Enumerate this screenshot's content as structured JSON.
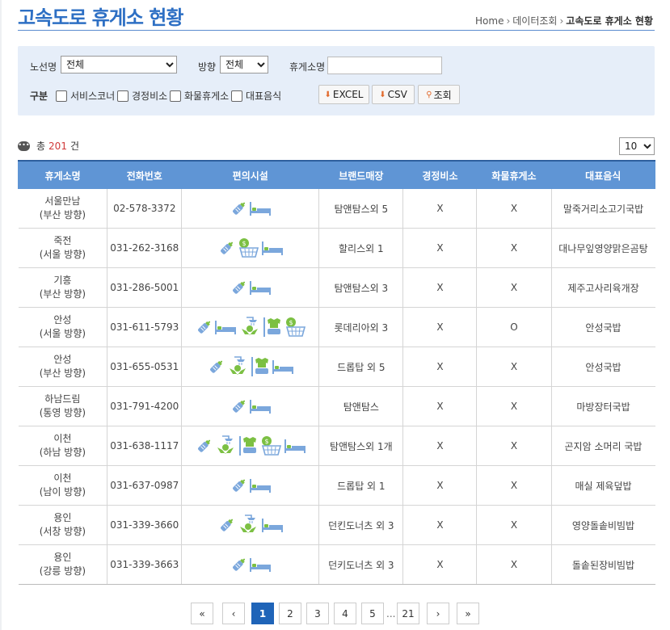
{
  "page": {
    "title": "고속도로 휴게소 현황",
    "breadcrumb": [
      "Home",
      "데이터조회",
      "고속도로 휴게소 현황"
    ]
  },
  "filter": {
    "route_label": "노선명",
    "route_value": "전체",
    "direction_label": "방향",
    "direction_value": "전체",
    "name_label": "휴게소명",
    "name_value": "",
    "category_label": "구분",
    "checkboxes": [
      "서비스코너",
      "경정비소",
      "화물휴게소",
      "대표음식"
    ],
    "excel_label": "EXCEL",
    "csv_label": "CSV",
    "search_label": "조회"
  },
  "summary": {
    "prefix": "총",
    "count": "201",
    "suffix": "건",
    "page_size": "10"
  },
  "table": {
    "headers": [
      "휴게소명",
      "전화번호",
      "편의시설",
      "브랜드매장",
      "경정비소",
      "화물휴게소",
      "대표음식"
    ],
    "rows": [
      {
        "name": "서울만남",
        "dir": "(부산 방향)",
        "phone": "02-578-3372",
        "facilities": [
          "nursing-bottle",
          "bed"
        ],
        "brand": "탐앤탐스외 5",
        "repair": "X",
        "truck": "X",
        "food": "말죽거리소고기국밥"
      },
      {
        "name": "죽전",
        "dir": "(서울 방향)",
        "phone": "031-262-3168",
        "facilities": [
          "nursing-bottle",
          "basket",
          "bed"
        ],
        "brand": "할리스외 1",
        "repair": "X",
        "truck": "X",
        "food": "대나무잎영양맑은곰탕"
      },
      {
        "name": "기흥",
        "dir": "(부산 방향)",
        "phone": "031-286-5001",
        "facilities": [
          "nursing-bottle",
          "bed"
        ],
        "brand": "탐앤탐스외 3",
        "repair": "X",
        "truck": "X",
        "food": "제주고사리육개장"
      },
      {
        "name": "안성",
        "dir": "(서울 방향)",
        "phone": "031-611-5793",
        "facilities": [
          "nursing-bottle",
          "bed",
          "shower",
          "laundry",
          "basket"
        ],
        "brand": "롯데리아외 3",
        "repair": "X",
        "truck": "O",
        "food": "안성국밥"
      },
      {
        "name": "안성",
        "dir": "(부산 방향)",
        "phone": "031-655-0531",
        "facilities": [
          "nursing-bottle",
          "shower",
          "laundry",
          "bed"
        ],
        "brand": "드롭탑 외 5",
        "repair": "X",
        "truck": "X",
        "food": "안성국밥"
      },
      {
        "name": "하남드림",
        "dir": "(통영 방향)",
        "phone": "031-791-4200",
        "facilities": [
          "nursing-bottle",
          "bed"
        ],
        "brand": "탐앤탐스",
        "repair": "X",
        "truck": "X",
        "food": "마방장터국밥"
      },
      {
        "name": "이천",
        "dir": "(하남 방향)",
        "phone": "031-638-1117",
        "facilities": [
          "nursing-bottle",
          "shower",
          "laundry",
          "basket",
          "bed"
        ],
        "brand": "탐앤탐스외 1개",
        "repair": "X",
        "truck": "X",
        "food": "곤지암 소머리 국밥"
      },
      {
        "name": "이천",
        "dir": "(남이 방향)",
        "phone": "031-637-0987",
        "facilities": [
          "nursing-bottle",
          "bed"
        ],
        "brand": "드롭탑 외 1",
        "repair": "X",
        "truck": "X",
        "food": "매실 제육덮밥"
      },
      {
        "name": "용인",
        "dir": "(서창 방향)",
        "phone": "031-339-3660",
        "facilities": [
          "nursing-bottle",
          "shower",
          "bed"
        ],
        "brand": "던킨도너츠 외 3",
        "repair": "X",
        "truck": "X",
        "food": "영양돌솥비빔밥"
      },
      {
        "name": "용인",
        "dir": "(강릉 방향)",
        "phone": "031-339-3663",
        "facilities": [
          "nursing-bottle",
          "bed"
        ],
        "brand": "던키도너츠 외 3",
        "repair": "X",
        "truck": "X",
        "food": "돌솥된장비빔밥"
      }
    ]
  },
  "pagination": {
    "first": "«",
    "prev": "‹",
    "pages": [
      "1",
      "2",
      "3",
      "4",
      "5"
    ],
    "ellipsis": "...",
    "last_page": "21",
    "next": "›",
    "last": "»",
    "current": "1"
  },
  "colors": {
    "title": "#2d6fc4",
    "header_bg": "#5f95d5",
    "filter_bg": "#e6eef9",
    "icon_blue": "#7ba7dc",
    "icon_green": "#7cc043",
    "accent_red": "#d03a3a",
    "active_page": "#1f64b8"
  }
}
